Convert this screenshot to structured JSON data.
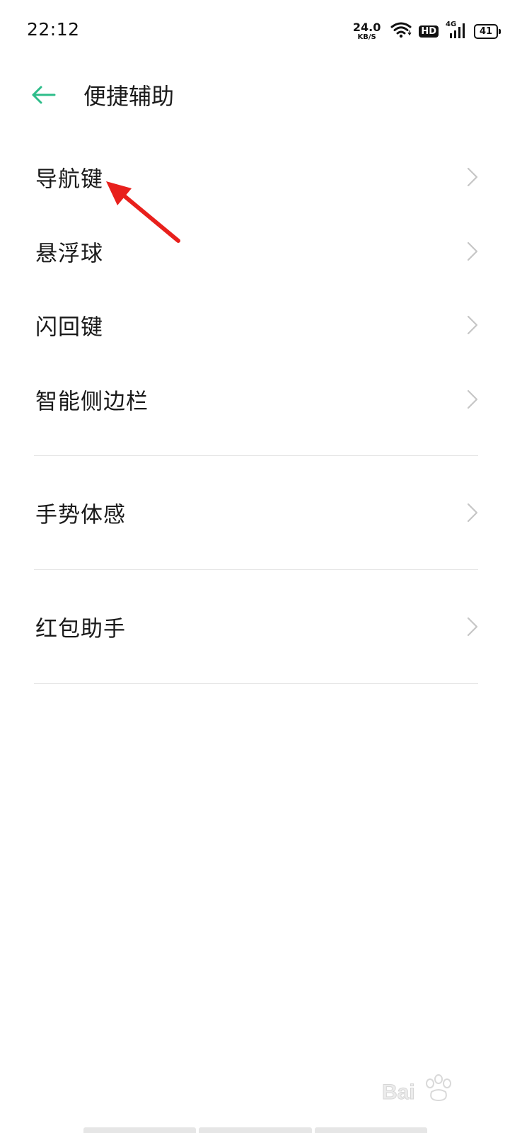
{
  "status_bar": {
    "time": "22:12",
    "net_speed_value": "24.0",
    "net_speed_unit": "KB/S",
    "hd_label": "HD",
    "network_label": "4G",
    "battery_level": "41"
  },
  "header": {
    "title": "便捷辅助"
  },
  "menu": {
    "items": [
      {
        "label": "导航键"
      },
      {
        "label": "悬浮球"
      },
      {
        "label": "闪回键"
      },
      {
        "label": "智能侧边栏"
      },
      {
        "label": "手势体感"
      },
      {
        "label": "红包助手"
      }
    ]
  },
  "colors": {
    "accent": "#2ebd8a",
    "annotation": "#e8201c",
    "chevron": "#c6c6c6",
    "divider": "#e3e3e3"
  },
  "icons": {
    "back": "arrow-left-icon",
    "chevron": "chevron-right-icon",
    "wifi": "wifi-icon",
    "signal": "cellular-signal-icon",
    "battery": "battery-icon"
  }
}
